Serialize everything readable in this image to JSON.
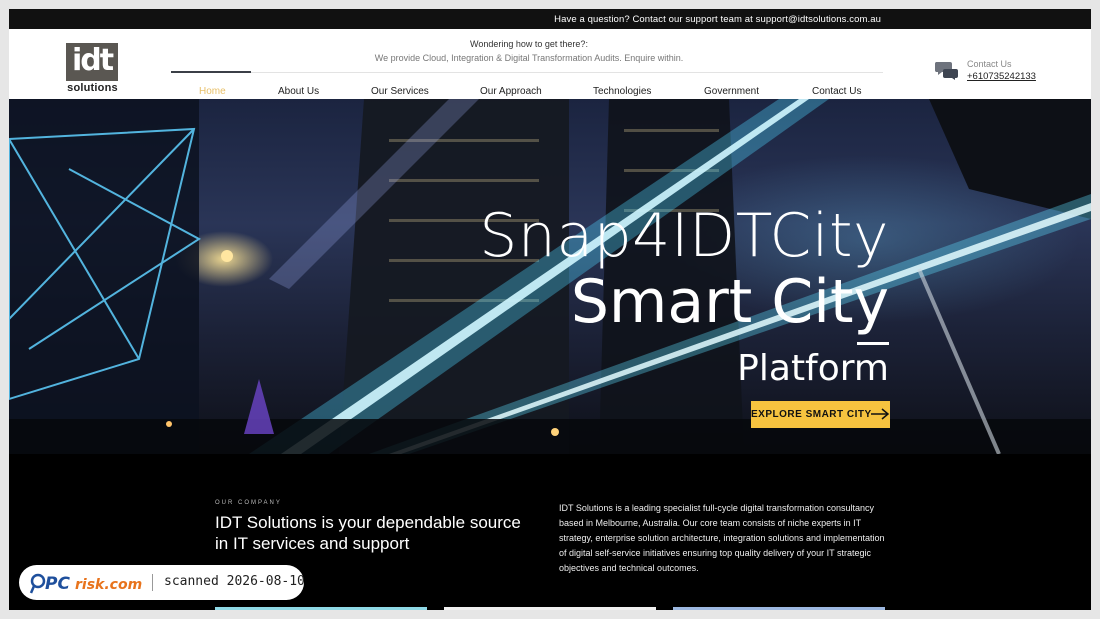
{
  "topbar": {
    "text": "Have a question? Contact our support team at support@idtsolutions.com.au"
  },
  "header": {
    "logo_mark": "idt",
    "logo_sub": "solutions",
    "tagline_title": "Wondering how to get there?:",
    "tagline_sub": "We provide Cloud, Integration & Digital Transformation Audits. Enquire within.",
    "contact_label": "Contact Us",
    "contact_phone": "+610735242133",
    "contact_icon": "chat-bubbles-icon"
  },
  "nav": {
    "items": [
      {
        "label": "Home",
        "active": true
      },
      {
        "label": "About Us",
        "active": false
      },
      {
        "label": "Our Services",
        "active": false
      },
      {
        "label": "Our Approach",
        "active": false
      },
      {
        "label": "Technologies",
        "active": false
      },
      {
        "label": "Government",
        "active": false
      },
      {
        "label": "Contact Us",
        "active": false
      }
    ],
    "active_color": "#e8c06a"
  },
  "hero": {
    "line1": "Snap4IDTCity",
    "line2": "Smart City",
    "line3": "Platform",
    "cta_label": "EXPLORE SMART CITY",
    "cta_color": "#f6c33f",
    "cta_icon": "arrow-right-icon"
  },
  "company": {
    "eyebrow": "OUR COMPANY",
    "title": "IDT Solutions is your dependable source in IT services and support",
    "description": "IDT Solutions is a leading specialist full-cycle digital transformation consultancy based in Melbourne, Australia. Our core team consists of niche experts in IT strategy, enterprise solution architecture, integration solutions and implementation of digital self-service initiatives ensuring top quality delivery of your IT strategic objectives and technical outcomes."
  },
  "watermark": {
    "brand": "PCrisk.com",
    "text": "scanned 2026-08-10"
  }
}
